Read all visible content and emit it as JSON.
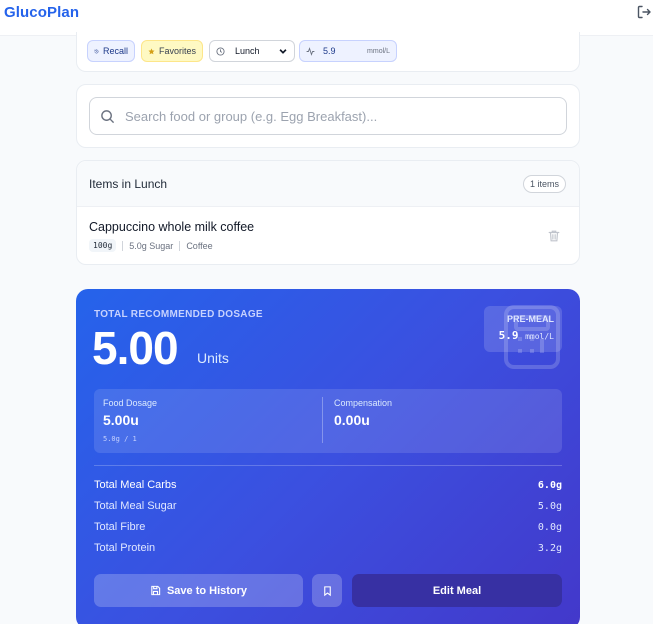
{
  "app": {
    "title": "GlucoPlan"
  },
  "filters": {
    "recall_label": "Recall",
    "favorites_label": "Favorites",
    "meal_selected": "Lunch",
    "glucose_value": "5.9",
    "glucose_unit": "mmol/L"
  },
  "search": {
    "placeholder": "Search food or group (e.g. Egg Breakfast)..."
  },
  "items": {
    "title": "Items in Lunch",
    "count_label": "1 items",
    "list": [
      {
        "name": "Cappuccino whole milk coffee",
        "weight": "100g",
        "sugar": "5.0g Sugar",
        "category": "Coffee"
      }
    ]
  },
  "dosage": {
    "label": "TOTAL RECOMMENDED DOSAGE",
    "value": "5.00",
    "unit": "Units",
    "premeal_label": "PRE-MEAL",
    "premeal_value": "5.9",
    "premeal_unit": "mmol/L",
    "food_dosage_label": "Food Dosage",
    "food_dosage_value": "5.00u",
    "food_dosage_formula": "5.0g / 1",
    "compensation_label": "Compensation",
    "compensation_value": "0.00u"
  },
  "totals": [
    {
      "label": "Total Meal Carbs",
      "value": "6.0g"
    },
    {
      "label": "Total Meal Sugar",
      "value": "5.0g"
    },
    {
      "label": "Total Fibre",
      "value": "0.0g"
    },
    {
      "label": "Total Protein",
      "value": "3.2g"
    }
  ],
  "actions": {
    "save_label": "Save to History",
    "edit_label": "Edit Meal"
  },
  "icons": {
    "logout": "logout-icon",
    "recall": "history-icon",
    "favorites": "star-icon",
    "meal": "clock-icon",
    "glucose": "activity-icon",
    "search": "search-icon",
    "trash": "trash-icon",
    "calculator": "calculator-icon",
    "save": "save-icon",
    "bookmark": "bookmark-icon"
  },
  "colors": {
    "brand": "#2563eb",
    "dosage_gradient_start": "#2563eb",
    "dosage_gradient_end": "#4338ca",
    "edit_button": "#3730a3"
  }
}
